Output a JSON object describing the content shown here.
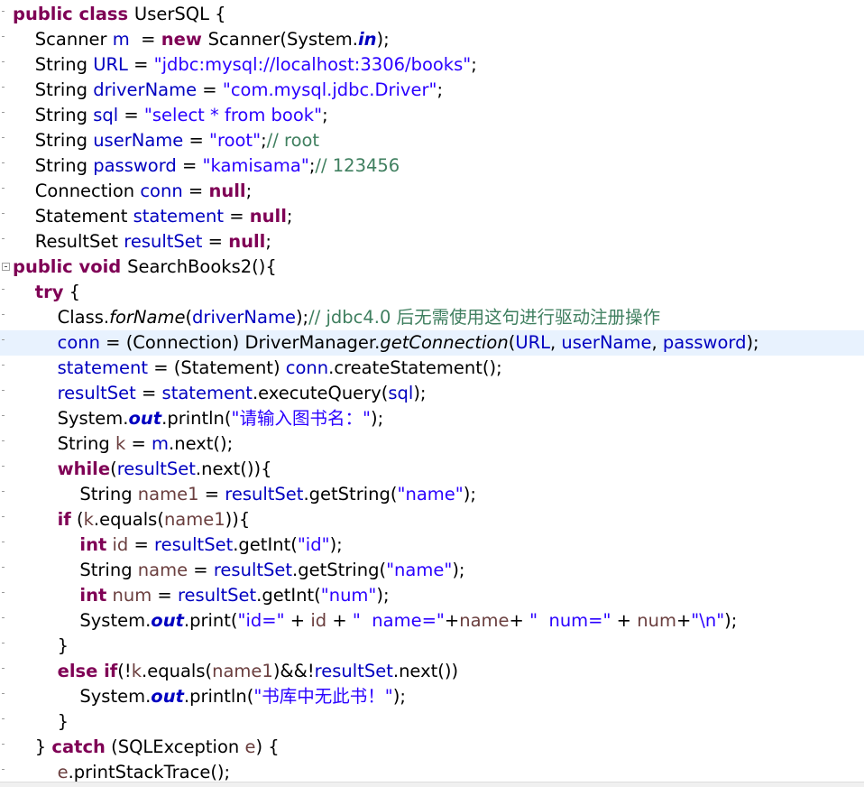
{
  "editor": {
    "highlight_line": 13,
    "lines": [
      [
        [
          "public class ",
          "kw"
        ],
        [
          "UserSQL {",
          ""
        ]
      ],
      [
        [
          "    Scanner ",
          ""
        ],
        [
          "m",
          "fld"
        ],
        [
          "  = ",
          ""
        ],
        [
          "new ",
          "kw"
        ],
        [
          "Scanner(System.",
          ""
        ],
        [
          "in",
          "st-fld"
        ],
        [
          ");",
          ""
        ]
      ],
      [
        [
          "    String ",
          ""
        ],
        [
          "URL",
          "fld"
        ],
        [
          " = ",
          ""
        ],
        [
          "\"jdbc:mysql://localhost:3306/books\"",
          "str"
        ],
        [
          ";",
          ""
        ]
      ],
      [
        [
          "    String ",
          ""
        ],
        [
          "driverName",
          "fld"
        ],
        [
          " = ",
          ""
        ],
        [
          "\"com.mysql.jdbc.Driver\"",
          "str"
        ],
        [
          ";",
          ""
        ]
      ],
      [
        [
          "    String ",
          ""
        ],
        [
          "sql",
          "fld"
        ],
        [
          " = ",
          ""
        ],
        [
          "\"select * from book\"",
          "str"
        ],
        [
          ";",
          ""
        ]
      ],
      [
        [
          "    String ",
          ""
        ],
        [
          "userName",
          "fld"
        ],
        [
          " = ",
          ""
        ],
        [
          "\"root\"",
          "str"
        ],
        [
          ";",
          ""
        ],
        [
          "// root",
          "com"
        ]
      ],
      [
        [
          "    String ",
          ""
        ],
        [
          "password",
          "fld"
        ],
        [
          " = ",
          ""
        ],
        [
          "\"kamisama\"",
          "str"
        ],
        [
          ";",
          ""
        ],
        [
          "// 123456",
          "com"
        ]
      ],
      [
        [
          "    Connection ",
          ""
        ],
        [
          "conn",
          "fld"
        ],
        [
          " = ",
          ""
        ],
        [
          "null",
          "kw"
        ],
        [
          ";",
          ""
        ]
      ],
      [
        [
          "    Statement ",
          ""
        ],
        [
          "statement",
          "fld"
        ],
        [
          " = ",
          ""
        ],
        [
          "null",
          "kw"
        ],
        [
          ";",
          ""
        ]
      ],
      [
        [
          "    ResultSet ",
          ""
        ],
        [
          "resultSet",
          "fld"
        ],
        [
          " = ",
          ""
        ],
        [
          "null",
          "kw"
        ],
        [
          ";",
          ""
        ]
      ],
      [
        [
          "public void ",
          "kw"
        ],
        [
          "SearchBooks2(){",
          ""
        ]
      ],
      [
        [
          "    ",
          ""
        ],
        [
          "try",
          "kw"
        ],
        [
          " {",
          ""
        ]
      ],
      [
        [
          "        Class.",
          ""
        ],
        [
          "forName",
          "st-it"
        ],
        [
          "(",
          ""
        ],
        [
          "driverName",
          "fld"
        ],
        [
          ");",
          ""
        ],
        [
          "// jdbc4.0 后无需使用这句进行驱动注册操作",
          "com"
        ]
      ],
      [
        [
          "        ",
          ""
        ],
        [
          "conn",
          "fld"
        ],
        [
          " = (Connection) DriverManager.",
          ""
        ],
        [
          "getConnection",
          "st-it"
        ],
        [
          "(",
          ""
        ],
        [
          "URL",
          "fld"
        ],
        [
          ", ",
          ""
        ],
        [
          "userName",
          "fld"
        ],
        [
          ", ",
          ""
        ],
        [
          "password",
          "fld"
        ],
        [
          ");",
          ""
        ]
      ],
      [
        [
          "        ",
          ""
        ],
        [
          "statement",
          "fld"
        ],
        [
          " = (Statement) ",
          ""
        ],
        [
          "conn",
          "fld"
        ],
        [
          ".createStatement();",
          ""
        ]
      ],
      [
        [
          "        ",
          ""
        ],
        [
          "resultSet",
          "fld"
        ],
        [
          " = ",
          ""
        ],
        [
          "statement",
          "fld"
        ],
        [
          ".executeQuery(",
          ""
        ],
        [
          "sql",
          "fld"
        ],
        [
          ");",
          ""
        ]
      ],
      [
        [
          "        System.",
          ""
        ],
        [
          "out",
          "st-fld"
        ],
        [
          ".println(",
          ""
        ],
        [
          "\"请输入图书名：\"",
          "str"
        ],
        [
          ");",
          ""
        ]
      ],
      [
        [
          "        String ",
          ""
        ],
        [
          "k",
          "var"
        ],
        [
          " = ",
          ""
        ],
        [
          "m",
          "fld"
        ],
        [
          ".next();",
          ""
        ]
      ],
      [
        [
          "        ",
          ""
        ],
        [
          "while",
          "kw"
        ],
        [
          "(",
          ""
        ],
        [
          "resultSet",
          "fld"
        ],
        [
          ".next()){",
          ""
        ]
      ],
      [
        [
          "            String ",
          ""
        ],
        [
          "name1",
          "var"
        ],
        [
          " = ",
          ""
        ],
        [
          "resultSet",
          "fld"
        ],
        [
          ".getString(",
          ""
        ],
        [
          "\"name\"",
          "str"
        ],
        [
          ");",
          ""
        ]
      ],
      [
        [
          "        ",
          ""
        ],
        [
          "if",
          "kw"
        ],
        [
          " (",
          ""
        ],
        [
          "k",
          "var"
        ],
        [
          ".equals(",
          ""
        ],
        [
          "name1",
          "var"
        ],
        [
          ")){",
          ""
        ]
      ],
      [
        [
          "            ",
          ""
        ],
        [
          "int",
          "kw"
        ],
        [
          " ",
          ""
        ],
        [
          "id",
          "var"
        ],
        [
          " = ",
          ""
        ],
        [
          "resultSet",
          "fld"
        ],
        [
          ".getInt(",
          ""
        ],
        [
          "\"id\"",
          "str"
        ],
        [
          ");",
          ""
        ]
      ],
      [
        [
          "            String ",
          ""
        ],
        [
          "name",
          "var"
        ],
        [
          " = ",
          ""
        ],
        [
          "resultSet",
          "fld"
        ],
        [
          ".getString(",
          ""
        ],
        [
          "\"name\"",
          "str"
        ],
        [
          ");",
          ""
        ]
      ],
      [
        [
          "            ",
          ""
        ],
        [
          "int",
          "kw"
        ],
        [
          " ",
          ""
        ],
        [
          "num",
          "var"
        ],
        [
          " = ",
          ""
        ],
        [
          "resultSet",
          "fld"
        ],
        [
          ".getInt(",
          ""
        ],
        [
          "\"num\"",
          "str"
        ],
        [
          ");",
          ""
        ]
      ],
      [
        [
          "            System.",
          ""
        ],
        [
          "out",
          "st-fld"
        ],
        [
          ".print(",
          ""
        ],
        [
          "\"id=\"",
          "str"
        ],
        [
          " + ",
          ""
        ],
        [
          "id",
          "var"
        ],
        [
          " + ",
          ""
        ],
        [
          "\"  name=\"",
          "str"
        ],
        [
          "+",
          ""
        ],
        [
          "name",
          "var"
        ],
        [
          "+ ",
          ""
        ],
        [
          "\"  num=\"",
          "str"
        ],
        [
          " + ",
          ""
        ],
        [
          "num",
          "var"
        ],
        [
          "+",
          ""
        ],
        [
          "\"\\n\"",
          "str"
        ],
        [
          ");",
          ""
        ]
      ],
      [
        [
          "        }",
          ""
        ]
      ],
      [
        [
          "        ",
          ""
        ],
        [
          "else if",
          "kw"
        ],
        [
          "(!",
          ""
        ],
        [
          "k",
          "var"
        ],
        [
          ".equals(",
          ""
        ],
        [
          "name1",
          "var"
        ],
        [
          ")&&!",
          ""
        ],
        [
          "resultSet",
          "fld"
        ],
        [
          ".next())",
          ""
        ]
      ],
      [
        [
          "            System.",
          ""
        ],
        [
          "out",
          "st-fld"
        ],
        [
          ".println(",
          ""
        ],
        [
          "\"书库中无此书！\"",
          "str"
        ],
        [
          ");",
          ""
        ]
      ],
      [
        [
          "        }",
          ""
        ]
      ],
      [
        [
          "    } ",
          ""
        ],
        [
          "catch",
          "kw"
        ],
        [
          " (SQLException ",
          ""
        ],
        [
          "e",
          "var"
        ],
        [
          ") {",
          ""
        ]
      ],
      [
        [
          "        ",
          ""
        ],
        [
          "e",
          "var"
        ],
        [
          ".printStackTrace();",
          ""
        ]
      ]
    ]
  }
}
